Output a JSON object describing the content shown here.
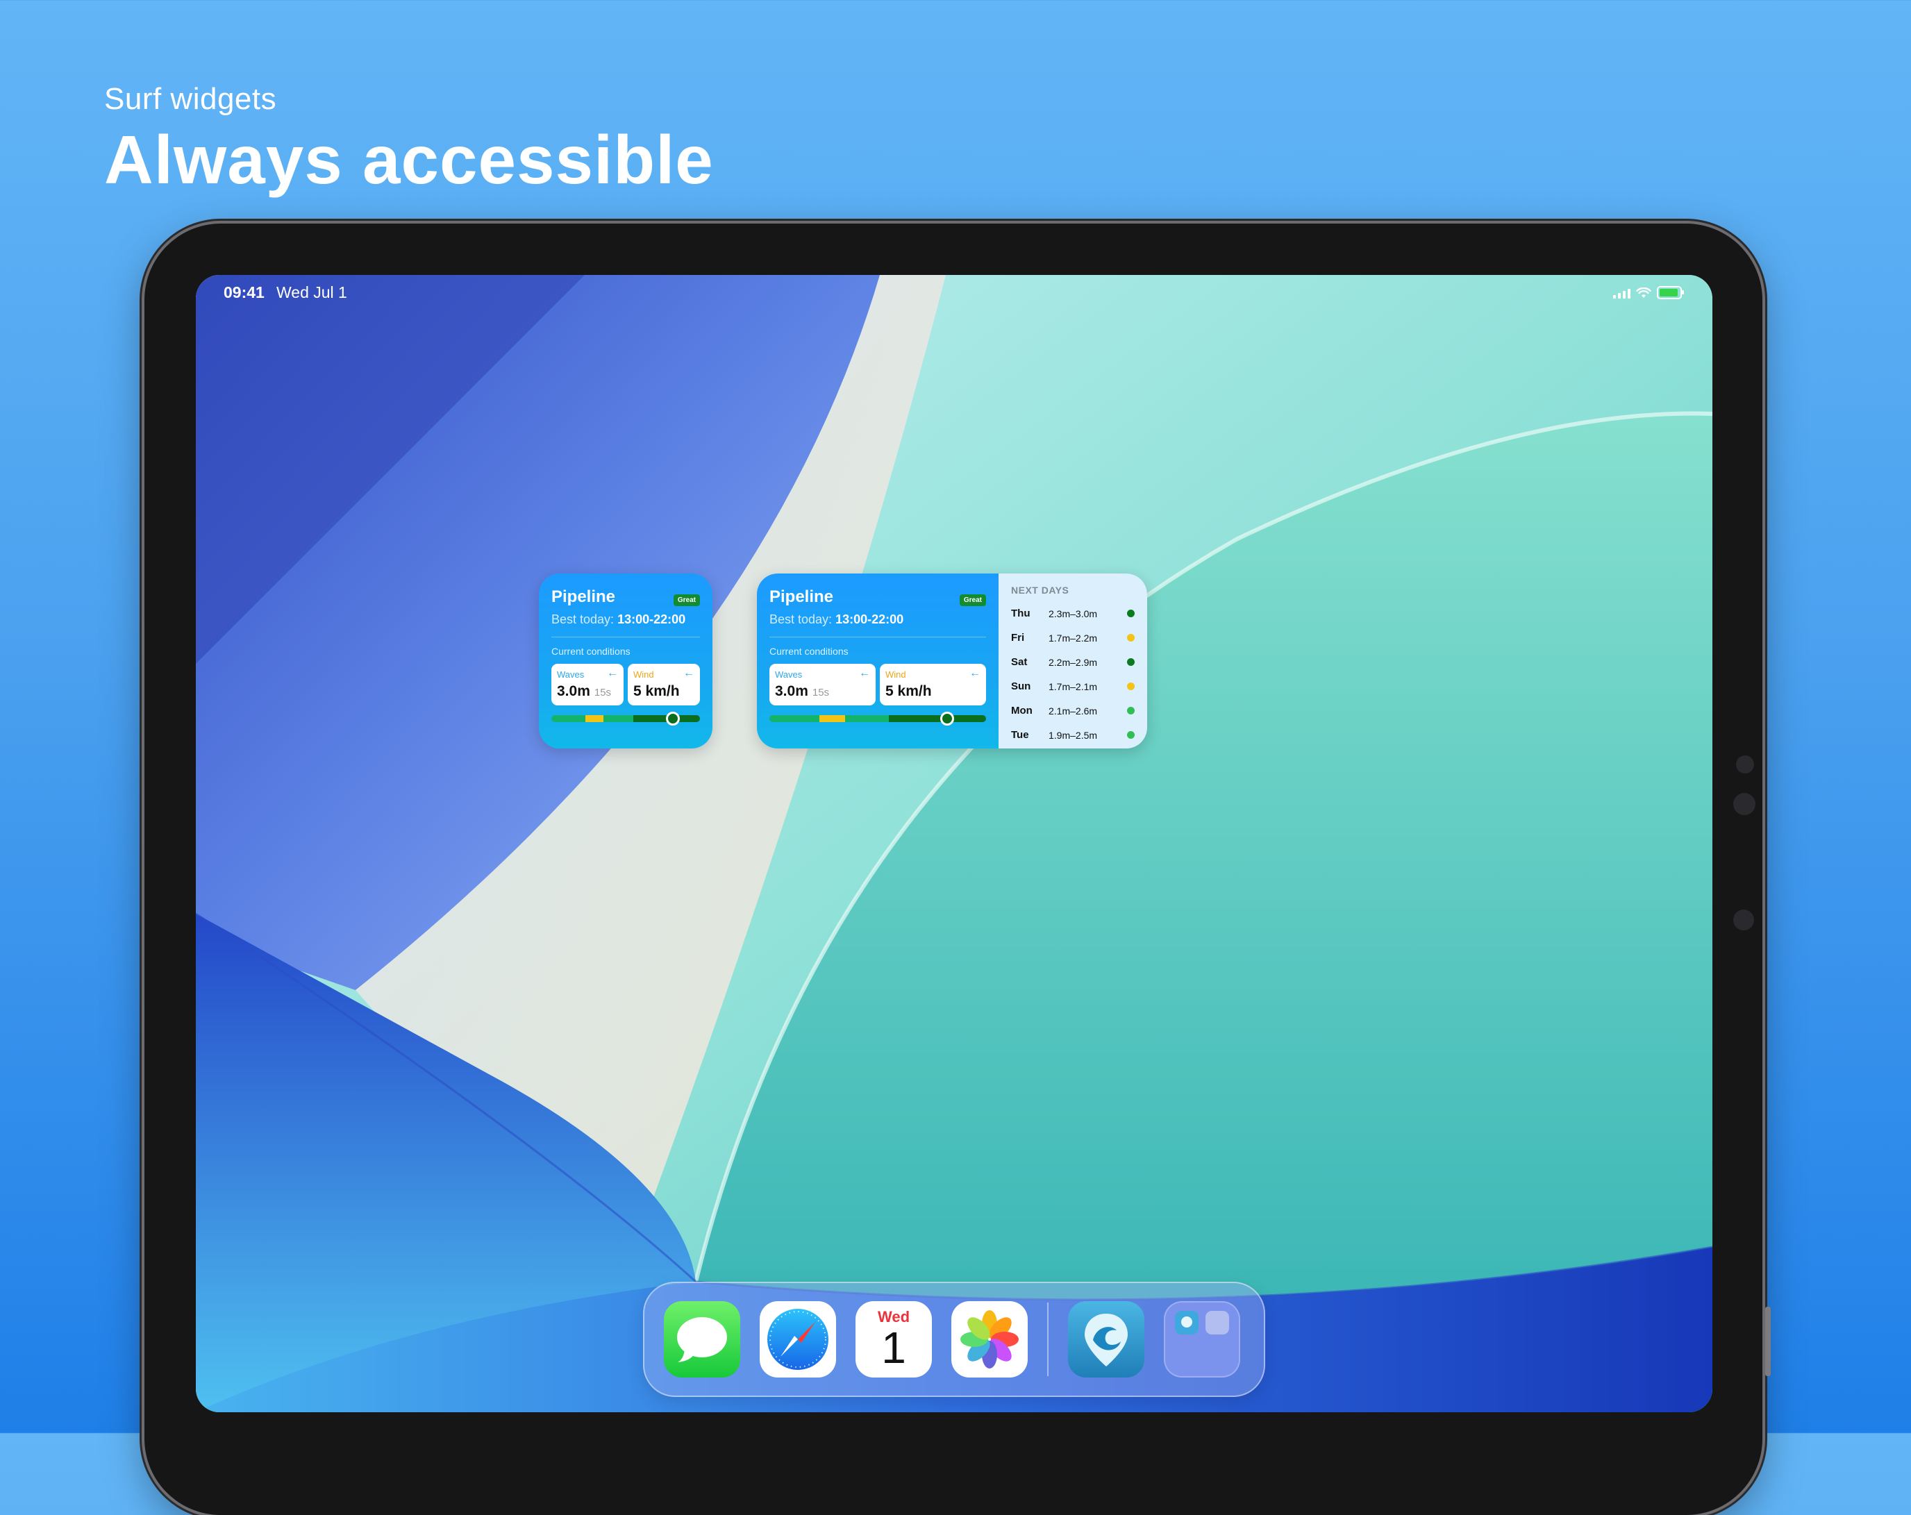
{
  "hero": {
    "subtitle": "Surf widgets",
    "title": "Always accessible"
  },
  "status_bar": {
    "time": "09:41",
    "date": "Wed Jul 1",
    "battery_color": "#37d34b"
  },
  "widget_small": {
    "spot": "Pipeline",
    "rating": "Great",
    "best_prefix": "Best today:",
    "best_time": "13:00-22:00",
    "conditions_label": "Current conditions",
    "waves_label": "Waves",
    "waves_value": "3.0m",
    "waves_period": "15s",
    "wind_label": "Wind",
    "wind_value": "5 km/h",
    "direction_arrow": "←",
    "timeline_position": 0.82
  },
  "widget_medium": {
    "spot": "Pipeline",
    "rating": "Great",
    "best_prefix": "Best today:",
    "best_time": "13:00-22:00",
    "conditions_label": "Current conditions",
    "waves_label": "Waves",
    "waves_value": "3.0m",
    "waves_period": "15s",
    "wind_label": "Wind",
    "wind_value": "5 km/h",
    "direction_arrow": "←",
    "timeline_position": 0.82,
    "next_days_title": "NEXT DAYS",
    "next_days": [
      {
        "day": "Thu",
        "range": "2.3m–3.0m",
        "color": "#0d7a21"
      },
      {
        "day": "Fri",
        "range": "1.7m–2.2m",
        "color": "#f3c316"
      },
      {
        "day": "Sat",
        "range": "2.2m–2.9m",
        "color": "#0d7a21"
      },
      {
        "day": "Sun",
        "range": "1.7m–2.1m",
        "color": "#f3c316"
      },
      {
        "day": "Mon",
        "range": "2.1m–2.6m",
        "color": "#2fbf55"
      },
      {
        "day": "Tue",
        "range": "1.9m–2.5m",
        "color": "#2fbf55"
      }
    ]
  },
  "dock": {
    "apps": [
      "messages-app",
      "safari-app",
      "calendar-app",
      "photos-app",
      "surf-app",
      "app-folder"
    ],
    "calendar_month": "Wed",
    "calendar_day": "1"
  }
}
